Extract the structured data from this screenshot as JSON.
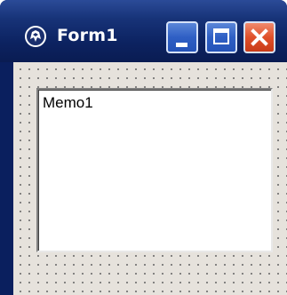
{
  "window": {
    "title": "Form1",
    "app_icon": "delphi-helmet-icon",
    "buttons": {
      "minimize": "minimize-icon",
      "maximize": "maximize-icon",
      "close": "close-icon"
    },
    "colors": {
      "titlebar": "#173378",
      "close_button": "#e0502a",
      "caption_buttons": "#2f5fc4",
      "client_area": "#e6e2dc"
    }
  },
  "form": {
    "memo": {
      "text": "Memo1"
    }
  }
}
